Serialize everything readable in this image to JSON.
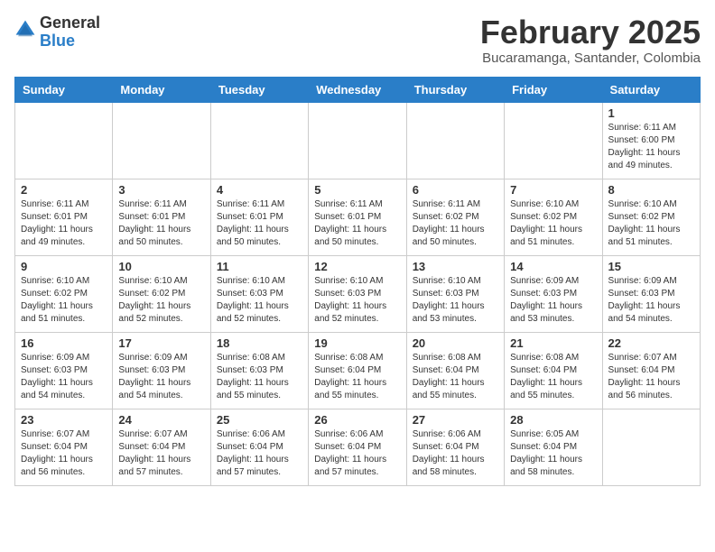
{
  "header": {
    "logo_general": "General",
    "logo_blue": "Blue",
    "title": "February 2025",
    "subtitle": "Bucaramanga, Santander, Colombia"
  },
  "calendar": {
    "columns": [
      "Sunday",
      "Monday",
      "Tuesday",
      "Wednesday",
      "Thursday",
      "Friday",
      "Saturday"
    ],
    "weeks": [
      [
        {
          "day": "",
          "info": ""
        },
        {
          "day": "",
          "info": ""
        },
        {
          "day": "",
          "info": ""
        },
        {
          "day": "",
          "info": ""
        },
        {
          "day": "",
          "info": ""
        },
        {
          "day": "",
          "info": ""
        },
        {
          "day": "1",
          "info": "Sunrise: 6:11 AM\nSunset: 6:00 PM\nDaylight: 11 hours\nand 49 minutes."
        }
      ],
      [
        {
          "day": "2",
          "info": "Sunrise: 6:11 AM\nSunset: 6:01 PM\nDaylight: 11 hours\nand 49 minutes."
        },
        {
          "day": "3",
          "info": "Sunrise: 6:11 AM\nSunset: 6:01 PM\nDaylight: 11 hours\nand 50 minutes."
        },
        {
          "day": "4",
          "info": "Sunrise: 6:11 AM\nSunset: 6:01 PM\nDaylight: 11 hours\nand 50 minutes."
        },
        {
          "day": "5",
          "info": "Sunrise: 6:11 AM\nSunset: 6:01 PM\nDaylight: 11 hours\nand 50 minutes."
        },
        {
          "day": "6",
          "info": "Sunrise: 6:11 AM\nSunset: 6:02 PM\nDaylight: 11 hours\nand 50 minutes."
        },
        {
          "day": "7",
          "info": "Sunrise: 6:10 AM\nSunset: 6:02 PM\nDaylight: 11 hours\nand 51 minutes."
        },
        {
          "day": "8",
          "info": "Sunrise: 6:10 AM\nSunset: 6:02 PM\nDaylight: 11 hours\nand 51 minutes."
        }
      ],
      [
        {
          "day": "9",
          "info": "Sunrise: 6:10 AM\nSunset: 6:02 PM\nDaylight: 11 hours\nand 51 minutes."
        },
        {
          "day": "10",
          "info": "Sunrise: 6:10 AM\nSunset: 6:02 PM\nDaylight: 11 hours\nand 52 minutes."
        },
        {
          "day": "11",
          "info": "Sunrise: 6:10 AM\nSunset: 6:03 PM\nDaylight: 11 hours\nand 52 minutes."
        },
        {
          "day": "12",
          "info": "Sunrise: 6:10 AM\nSunset: 6:03 PM\nDaylight: 11 hours\nand 52 minutes."
        },
        {
          "day": "13",
          "info": "Sunrise: 6:10 AM\nSunset: 6:03 PM\nDaylight: 11 hours\nand 53 minutes."
        },
        {
          "day": "14",
          "info": "Sunrise: 6:09 AM\nSunset: 6:03 PM\nDaylight: 11 hours\nand 53 minutes."
        },
        {
          "day": "15",
          "info": "Sunrise: 6:09 AM\nSunset: 6:03 PM\nDaylight: 11 hours\nand 54 minutes."
        }
      ],
      [
        {
          "day": "16",
          "info": "Sunrise: 6:09 AM\nSunset: 6:03 PM\nDaylight: 11 hours\nand 54 minutes."
        },
        {
          "day": "17",
          "info": "Sunrise: 6:09 AM\nSunset: 6:03 PM\nDaylight: 11 hours\nand 54 minutes."
        },
        {
          "day": "18",
          "info": "Sunrise: 6:08 AM\nSunset: 6:03 PM\nDaylight: 11 hours\nand 55 minutes."
        },
        {
          "day": "19",
          "info": "Sunrise: 6:08 AM\nSunset: 6:04 PM\nDaylight: 11 hours\nand 55 minutes."
        },
        {
          "day": "20",
          "info": "Sunrise: 6:08 AM\nSunset: 6:04 PM\nDaylight: 11 hours\nand 55 minutes."
        },
        {
          "day": "21",
          "info": "Sunrise: 6:08 AM\nSunset: 6:04 PM\nDaylight: 11 hours\nand 55 minutes."
        },
        {
          "day": "22",
          "info": "Sunrise: 6:07 AM\nSunset: 6:04 PM\nDaylight: 11 hours\nand 56 minutes."
        }
      ],
      [
        {
          "day": "23",
          "info": "Sunrise: 6:07 AM\nSunset: 6:04 PM\nDaylight: 11 hours\nand 56 minutes."
        },
        {
          "day": "24",
          "info": "Sunrise: 6:07 AM\nSunset: 6:04 PM\nDaylight: 11 hours\nand 57 minutes."
        },
        {
          "day": "25",
          "info": "Sunrise: 6:06 AM\nSunset: 6:04 PM\nDaylight: 11 hours\nand 57 minutes."
        },
        {
          "day": "26",
          "info": "Sunrise: 6:06 AM\nSunset: 6:04 PM\nDaylight: 11 hours\nand 57 minutes."
        },
        {
          "day": "27",
          "info": "Sunrise: 6:06 AM\nSunset: 6:04 PM\nDaylight: 11 hours\nand 58 minutes."
        },
        {
          "day": "28",
          "info": "Sunrise: 6:05 AM\nSunset: 6:04 PM\nDaylight: 11 hours\nand 58 minutes."
        },
        {
          "day": "",
          "info": ""
        }
      ]
    ]
  }
}
